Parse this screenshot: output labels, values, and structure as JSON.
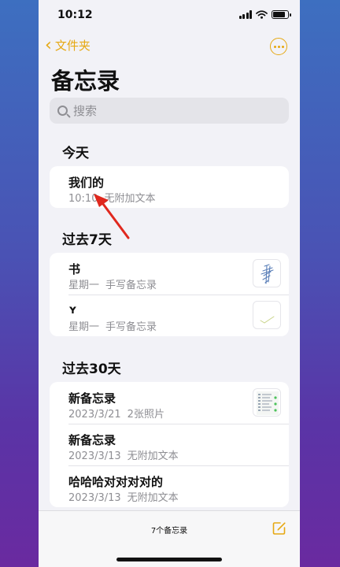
{
  "status": {
    "time": "10:12"
  },
  "nav": {
    "back_label": "文件夹"
  },
  "page": {
    "title": "备忘录"
  },
  "search": {
    "placeholder": "搜索"
  },
  "sections": [
    {
      "title": "今天",
      "notes": [
        {
          "title": "我们的",
          "date": "10:10",
          "preview": "无附加文本"
        }
      ]
    },
    {
      "title": "过去7天",
      "notes": [
        {
          "title": "书",
          "date": "星期一",
          "preview": "手写备忘录",
          "thumbnail": "handwriting-sketch"
        },
        {
          "title": "ʏ",
          "date": "星期一",
          "preview": "手写备忘录",
          "thumbnail": "handwriting-sketch"
        }
      ]
    },
    {
      "title": "过去30天",
      "notes": [
        {
          "title": "新备忘录",
          "date": "2023/3/21",
          "preview": "2张照片",
          "thumbnail": "photo"
        },
        {
          "title": "新备忘录",
          "date": "2023/3/13",
          "preview": "无附加文本"
        },
        {
          "title": "哈哈哈对对对对的",
          "date": "2023/3/13",
          "preview": "无附加文本"
        }
      ]
    }
  ],
  "footer": {
    "count_label": "7个备忘录"
  },
  "colors": {
    "accent": "#e6a812",
    "annotation_arrow": "#e0281e"
  }
}
